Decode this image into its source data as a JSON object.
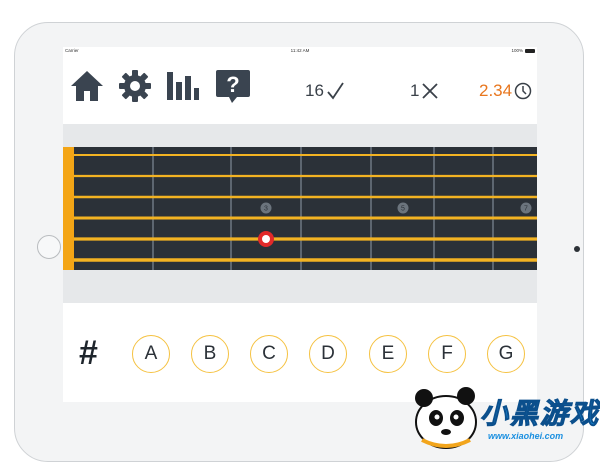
{
  "status_bar": {
    "carrier": "Carrier",
    "time": "11:42 AM",
    "battery": "100%"
  },
  "toolbar": {
    "icons": [
      "home-icon",
      "gear-icon",
      "bar-chart-icon",
      "help-icon"
    ],
    "correct_count": "16",
    "wrong_count": "1",
    "timer": "2.34",
    "timer_color": "#e8761e"
  },
  "fretboard": {
    "strings": 6,
    "fret_markers": [
      "3",
      "5",
      "7"
    ],
    "selected_note": {
      "string": 5,
      "fret": 3
    },
    "string_color": "#f3b322",
    "board_color": "#2b3138"
  },
  "answers": {
    "sharp_label": "#",
    "notes": [
      "A",
      "B",
      "C",
      "D",
      "E",
      "F",
      "G"
    ],
    "accent": "#f5c242"
  },
  "watermark": {
    "brand": "小黑游戏",
    "url": "www.xiaohei.com"
  }
}
